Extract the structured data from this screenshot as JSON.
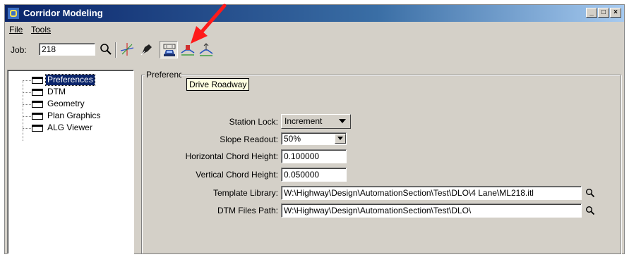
{
  "window": {
    "title": "Corridor Modeling",
    "minimize_label": "_",
    "maximize_label": "□",
    "close_label": "×"
  },
  "menu": {
    "file": "File",
    "tools": "Tools"
  },
  "toolbar": {
    "job_label": "Job:",
    "job_value": "218",
    "icons": [
      "search-icon",
      "axis-icon",
      "pen-icon",
      "drive-roadway-icon",
      "cross-section-icon",
      "template-icon"
    ],
    "highlight_color": "#ff1a1a"
  },
  "tree": {
    "items": [
      {
        "label": "Preferences",
        "selected": true
      },
      {
        "label": "DTM",
        "selected": false
      },
      {
        "label": "Geometry",
        "selected": false
      },
      {
        "label": "Plan Graphics",
        "selected": false
      },
      {
        "label": "ALG Viewer",
        "selected": false
      }
    ]
  },
  "preferences": {
    "group_title": "Preferences",
    "tooltip": "Drive Roadway",
    "station_lock": {
      "label": "Station Lock:",
      "value": "Increment"
    },
    "slope_readout": {
      "label": "Slope Readout:",
      "value": "50%"
    },
    "horizontal_chord": {
      "label": "Horizontal Chord Height:",
      "value": "0.100000"
    },
    "vertical_chord": {
      "label": "Vertical Chord Height:",
      "value": "0.050000"
    },
    "template_library": {
      "label": "Template Library:",
      "value": "W:\\Highway\\Design\\AutomationSection\\Test\\DLO\\4 Lane\\ML218.itl"
    },
    "dtm_files_path": {
      "label": "DTM Files Path:",
      "value": "W:\\Highway\\Design\\AutomationSection\\Test\\DLO\\"
    }
  }
}
